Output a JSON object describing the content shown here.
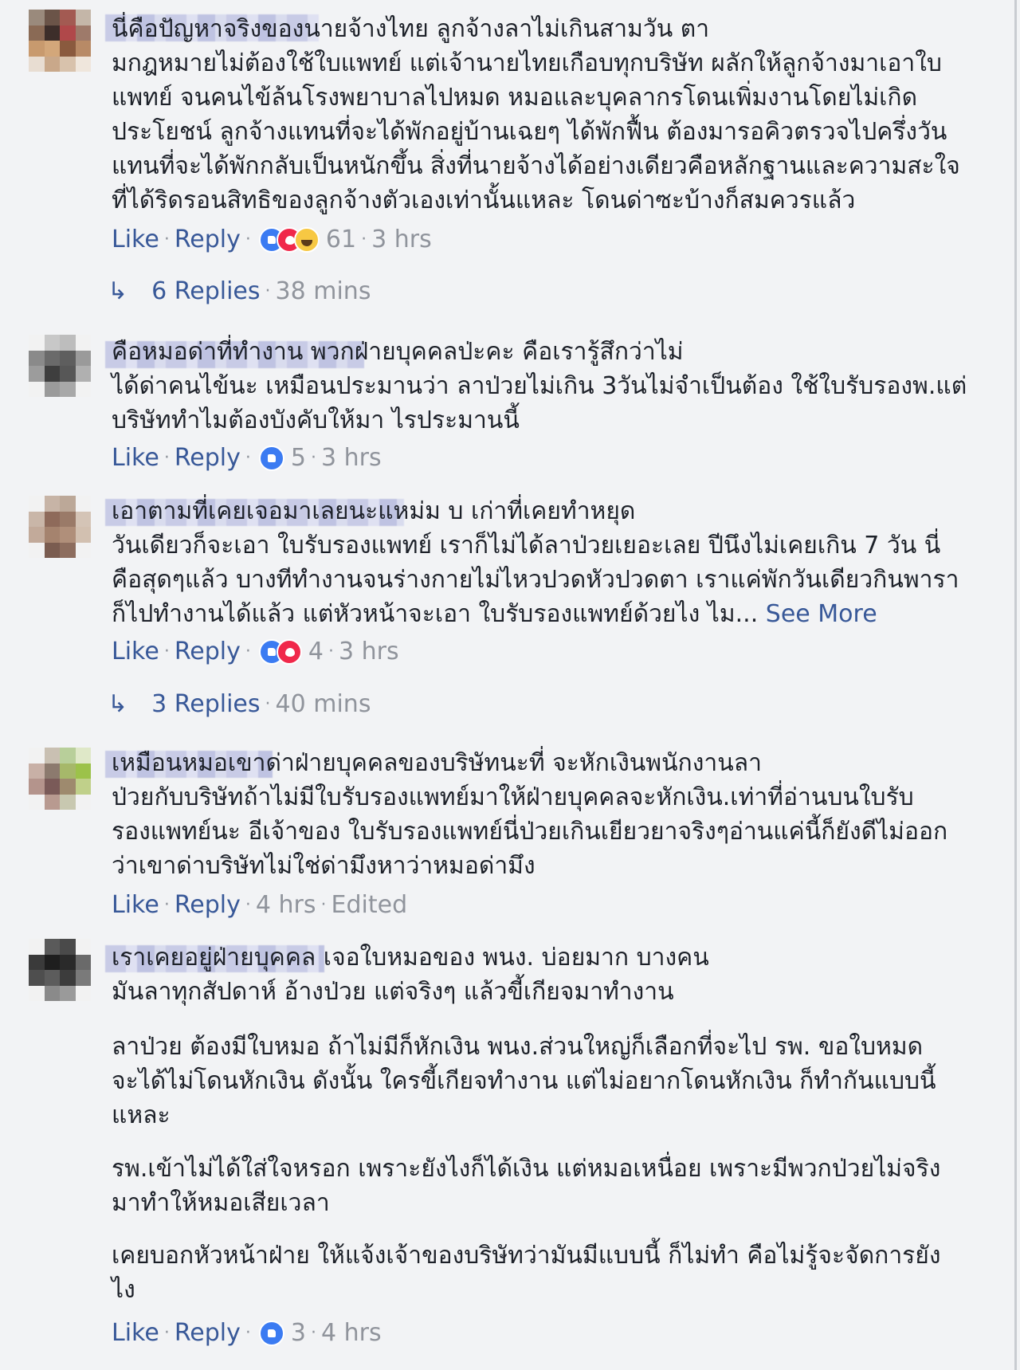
{
  "labels": {
    "like": "Like",
    "reply": "Reply",
    "see_more": "See More",
    "sep": "·"
  },
  "comments": [
    {
      "text": "นี่คือปัญหาจริงของนายจ้างไทย ลูกจ้างลาไม่เกินสามวัน ตา\nมกฎหมายไม่ต้องใช้ใบแพทย์ แต่เจ้านายไทยเกือบทุกบริษัท ผลักให้ลูกจ้างมาเอาใบ\nแพทย์ จนคนไข้ล้นโรงพยาบาลไปหมด หมอและบุคลากรโดนเพิ่มงานโดยไม่เกิด\nประโยชน์ ลูกจ้างแทนที่จะได้พักอยู่บ้านเฉยๆ ได้พักฟื้น ต้องมารอคิวตรวจไปครึ่งวัน\nแทนที่จะได้พักกลับเป็นหนักขึ้น สิ่งที่นายจ้างได้อย่างเดียวคือหลักฐานและความสะใจ\nที่ได้ริดรอนสิทธิของลูกจ้างตัวเองเท่านั้นแหละ โดนด่าซะบ้างก็สมควรแล้ว",
      "reaction_count": "61",
      "time": "3 hrs",
      "replies": {
        "label": "6 Replies",
        "time": "38 mins"
      }
    },
    {
      "text": "คือหมอด่าที่ทำงาน พวกฝ่ายบุคคลป่ะคะ คือเรารู้สึกว่าไม่\nได้ด่าคนไข้นะ เหมือนประมานว่า ลาป่วยไม่เกิน 3วันไม่จำเป็นต้อง ใช้ใบรับรองพ.แต่\nบริษัททำไมต้องบังคับให้มา ไรประมานนี้",
      "reaction_count": "5",
      "time": "3 hrs"
    },
    {
      "text": "เอาตามที่เคยเจอมาเลยนะแหม่ม บ เก่าที่เคยทำหยุด\nวันเดียวก็จะเอา ใบรับรองแพทย์ เราก็ไม่ได้ลาป่วยเยอะเลย ปีนึงไม่เคยเกิน 7 วัน นี่\nคือสุดๆแล้ว บางทีทำงานจนร่างกายไม่ไหวปวดหัวปวดตา เราแค่พักวันเดียวกินพารา\nก็ไปทำงานได้แล้ว แต่หัวหน้าจะเอา ใบรับรองแพทย์ด้วยไง ไม...",
      "reaction_count": "4",
      "time": "3 hrs",
      "replies": {
        "label": "3 Replies",
        "time": "40 mins"
      }
    },
    {
      "text": "เหมือนหมอเขาด่าฝ่ายบุคคลของบริษัทนะที่ จะหักเงินพนักงานลา\nป่วยกับบริษัทถ้าไม่มีใบรับรองแพทย์มาให้ฝ่ายบุคคลจะหักเงิน.เท่าที่อ่านบนใบรับ\nรองแพทย์นะ อีเจ้าของ ใบรับรองแพทย์นี่ป่วยเกินเยียวยาจริงๆอ่านแค่นี้ก็ยังดีไม่ออก\nว่าเขาด่าบริษัทไม่ใช่ด่ามึงหาว่าหมอด่ามึง",
      "time": "4 hrs",
      "edited": "Edited"
    },
    {
      "text": "เราเคยอยู่ฝ่ายบุคคล เจอใบหมอของ พนง. บ่อยมาก บางคน\nมันลาทุกสัปดาห์ อ้างป่วย แต่จริงๆ แล้วขี้เกียจมาทำงาน",
      "paragraphs": [
        "ลาป่วย ต้องมีใบหมอ ถ้าไม่มีก็หักเงิน พนง.ส่วนใหญ่ก็เลือกที่จะไป รพ. ขอใบหมด\nจะได้ไม่โดนหักเงิน ดังนั้น ใครขี้เกียจทำงาน แต่ไม่อยากโดนหักเงิน ก็ทำกันแบบนี้\nแหละ",
        "รพ.เข้าไม่ได้ใส่ใจหรอก เพราะยังไงก็ได้เงิน แต่หมอเหนื่อย เพราะมีพวกป่วยไม่จริง\nมาทำให้หมอเสียเวลา",
        "เคยบอกหัวหน้าฝ่าย ให้แจ้งเจ้าของบริษัทว่ามันมีแบบนี้ ก็ไม่ทำ คือไม่รู้จะจัดการยัง\nไง"
      ],
      "reaction_count": "3",
      "time": "4 hrs"
    }
  ]
}
